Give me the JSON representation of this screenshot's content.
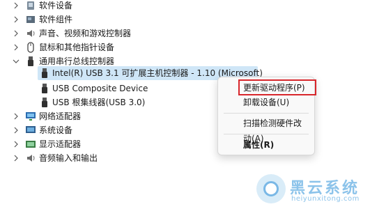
{
  "tree": {
    "items": [
      {
        "label": "软件设备",
        "icon": "software-device-icon",
        "expanded": false
      },
      {
        "label": "软件组件",
        "icon": "software-component-icon",
        "expanded": false
      },
      {
        "label": "声音、视频和游戏控制器",
        "icon": "speaker-icon",
        "expanded": false
      },
      {
        "label": "鼠标和其他指针设备",
        "icon": "mouse-icon",
        "expanded": false
      },
      {
        "label": "通用串行总线控制器",
        "icon": "usb-icon",
        "expanded": true
      },
      {
        "label": "Intel(R) USB 3.1 可扩展主机控制器 - 1.10 (Microsoft)",
        "icon": "usb-plug-icon",
        "selected": true
      },
      {
        "label": "USB Composite Device",
        "icon": "usb-plug-icon"
      },
      {
        "label": "USB 根集线器(USB 3.0)",
        "icon": "usb-plug-icon"
      },
      {
        "label": "网络适配器",
        "icon": "network-adapter-icon",
        "expanded": false
      },
      {
        "label": "系统设备",
        "icon": "system-device-icon",
        "expanded": false
      },
      {
        "label": "显示适配器",
        "icon": "display-adapter-icon",
        "expanded": false
      },
      {
        "label": "音频输入和输出",
        "icon": "audio-io-icon",
        "expanded": false
      }
    ]
  },
  "context_menu": {
    "update_driver": "更新驱动程序(P)",
    "uninstall": "卸载设备(U)",
    "scan": "扫描检测硬件改动(A)",
    "properties": "属性(R)"
  },
  "colors": {
    "highlight_border": "#d8262b",
    "selection": "#cfe6f7",
    "watermark": "#8cc3ea"
  },
  "watermark": {
    "title": "黑云系统",
    "url": "heiyunxitong.com"
  }
}
